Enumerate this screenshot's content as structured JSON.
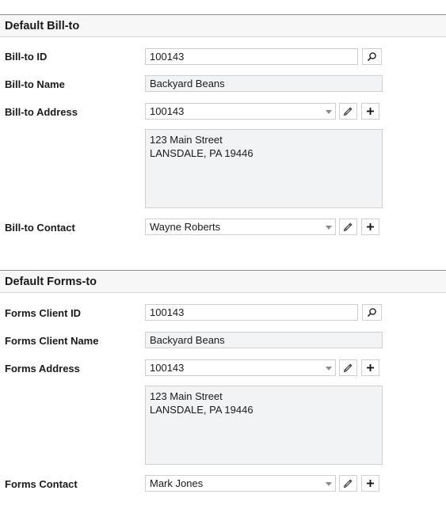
{
  "bill_to": {
    "section_title": "Default Bill-to",
    "id_label": "Bill-to ID",
    "id_value": "100143",
    "name_label": "Bill-to Name",
    "name_value": "Backyard Beans",
    "address_label": "Bill-to Address",
    "address_value": "100143",
    "address_lines": [
      "123 Main Street",
      "LANSDALE, PA 19446"
    ],
    "contact_label": "Bill-to Contact",
    "contact_value": "Wayne Roberts"
  },
  "forms_to": {
    "section_title": "Default Forms-to",
    "id_label": "Forms Client ID",
    "id_value": "100143",
    "name_label": "Forms Client Name",
    "name_value": "Backyard Beans",
    "address_label": "Forms Address",
    "address_value": "100143",
    "address_lines": [
      "123 Main Street",
      "LANSDALE, PA 19446"
    ],
    "contact_label": "Forms Contact",
    "contact_value": "Mark Jones"
  },
  "icons": {
    "lookup": "search-icon",
    "edit": "pencil-icon",
    "add": "plus-icon",
    "dropdown": "chevron-down-icon"
  },
  "colors": {
    "section_rule": "#8f8f8f",
    "field_border": "#cfcfcf",
    "readonly_bg": "#f2f3f5"
  }
}
